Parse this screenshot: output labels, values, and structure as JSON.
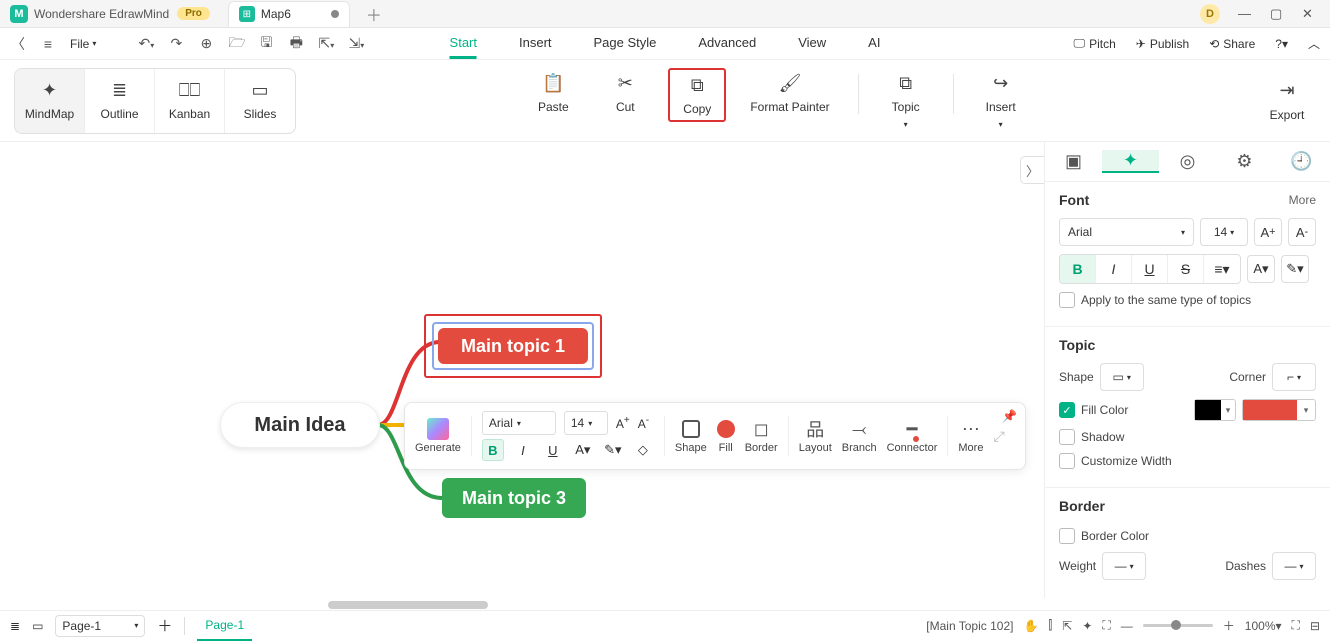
{
  "app": {
    "name": "Wondershare EdrawMind",
    "badge": "Pro",
    "user": "D"
  },
  "tab": {
    "title": "Map6"
  },
  "menubar": {
    "file": "File",
    "tabs": [
      "Start",
      "Insert",
      "Page Style",
      "Advanced",
      "View",
      "AI"
    ],
    "activeTab": "Start",
    "right": {
      "pitch": "Pitch",
      "publish": "Publish",
      "share": "Share"
    }
  },
  "ribbon": {
    "views": [
      "MindMap",
      "Outline",
      "Kanban",
      "Slides"
    ],
    "activeView": "MindMap",
    "buttons": {
      "paste": "Paste",
      "cut": "Cut",
      "copy": "Copy",
      "formatPainter": "Format Painter",
      "topic": "Topic",
      "insert": "Insert",
      "export": "Export"
    }
  },
  "mindmap": {
    "mainIdea": "Main Idea",
    "topic1": "Main topic 1",
    "topic3": "Main topic 3"
  },
  "floatToolbar": {
    "generate": "Generate",
    "font": "Arial",
    "size": "14",
    "shape": "Shape",
    "fill": "Fill",
    "border": "Border",
    "layout": "Layout",
    "branch": "Branch",
    "connector": "Connector",
    "more": "More"
  },
  "sidebar": {
    "font": {
      "title": "Font",
      "more": "More",
      "family": "Arial",
      "size": "14",
      "apply": "Apply to the same type of topics"
    },
    "topic": {
      "title": "Topic",
      "shape": "Shape",
      "corner": "Corner",
      "fillColor": "Fill Color",
      "shadow": "Shadow",
      "customize": "Customize Width"
    },
    "border": {
      "title": "Border",
      "color": "Border Color",
      "weight": "Weight",
      "dashes": "Dashes"
    }
  },
  "status": {
    "pageSelect": "Page-1",
    "pageTab": "Page-1",
    "selection": "[Main Topic 102]",
    "zoom": "100%"
  }
}
